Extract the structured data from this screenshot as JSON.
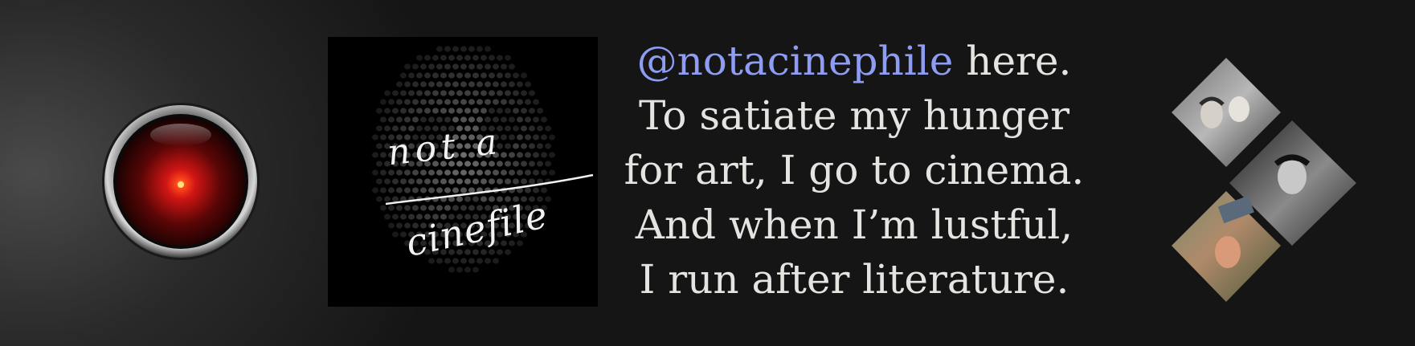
{
  "logo": {
    "line1": "not a",
    "line2": "cinefile"
  },
  "bio": {
    "handle": "@notacinephile",
    "line1_rest": " here.",
    "line2": "To satiate my hunger",
    "line3": "for art, I go to cinema.",
    "line4": "And when I’m lustful,",
    "line5": "I run after literature."
  },
  "colors": {
    "handle": "#8e9cf2",
    "text": "#e4e4e0",
    "background": "#141414",
    "hal_red": "#d01515"
  },
  "icons": {
    "hal_eye": "hal-9000-eye-icon"
  }
}
